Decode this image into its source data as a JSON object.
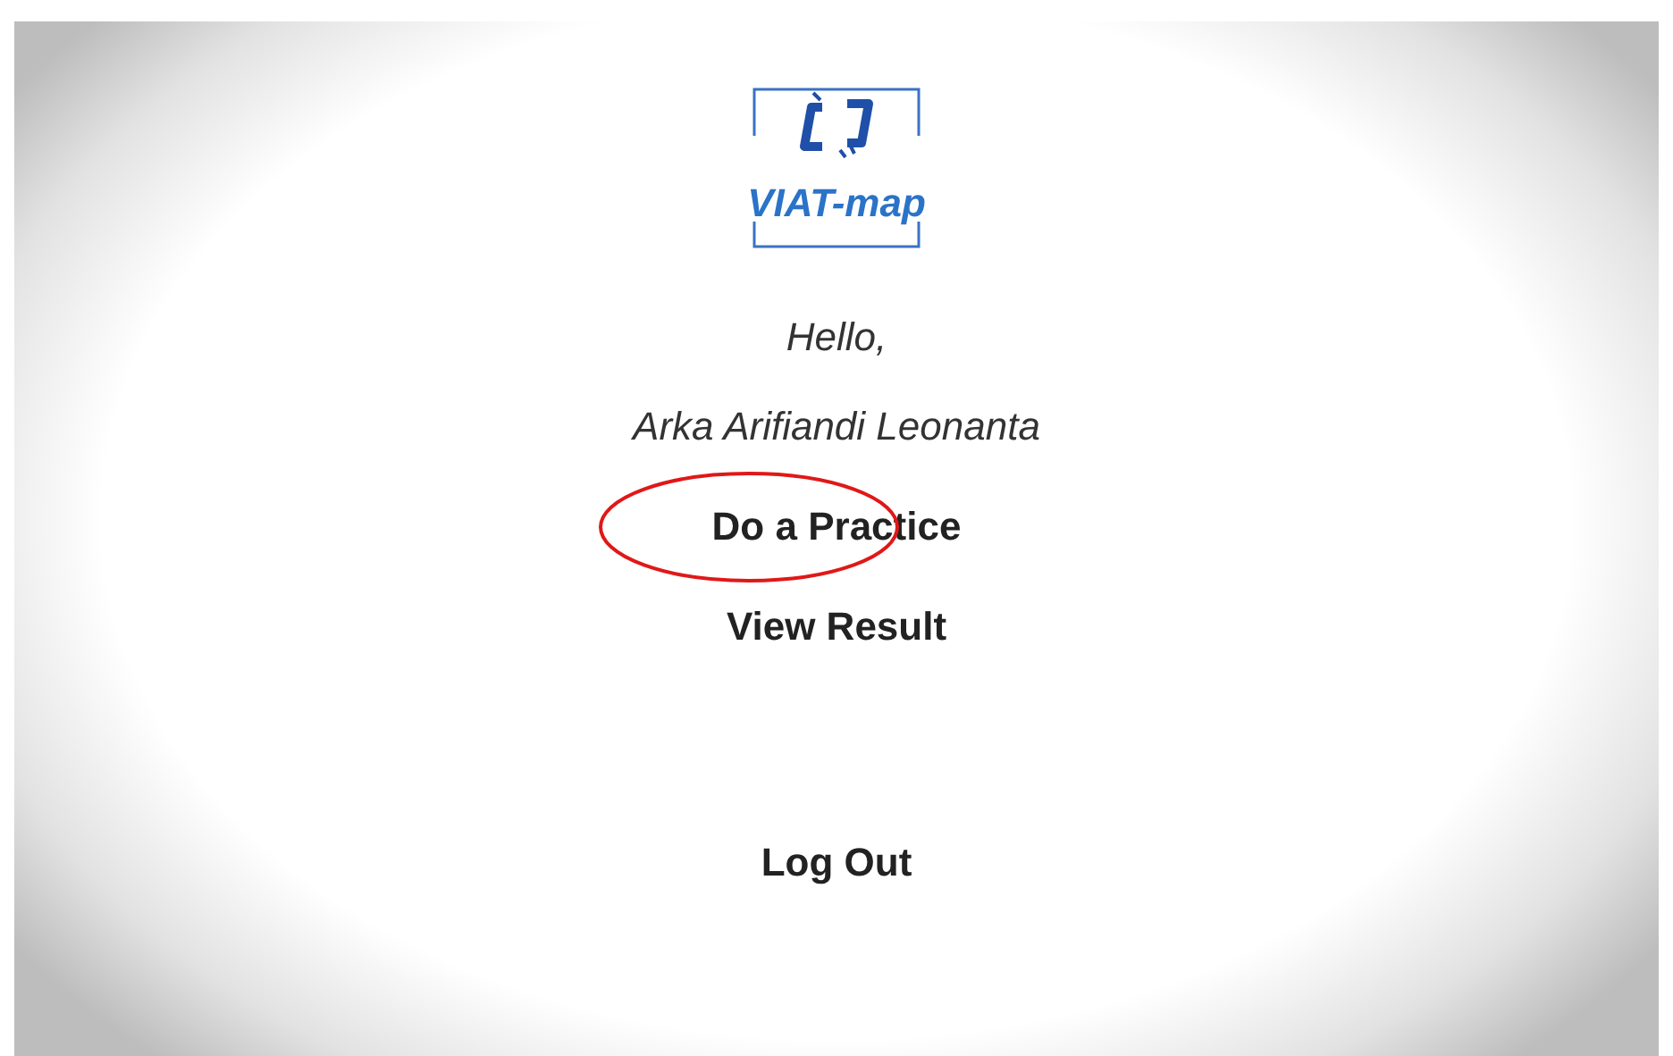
{
  "logo": {
    "text": "VIAT-map"
  },
  "greeting": "Hello,",
  "user_name": "Arka Arifiandi Leonanta",
  "menu": [
    {
      "label": "Do a Practice",
      "highlighted": true
    },
    {
      "label": "View Result",
      "highlighted": false
    }
  ],
  "logout": {
    "label": "Log Out"
  }
}
